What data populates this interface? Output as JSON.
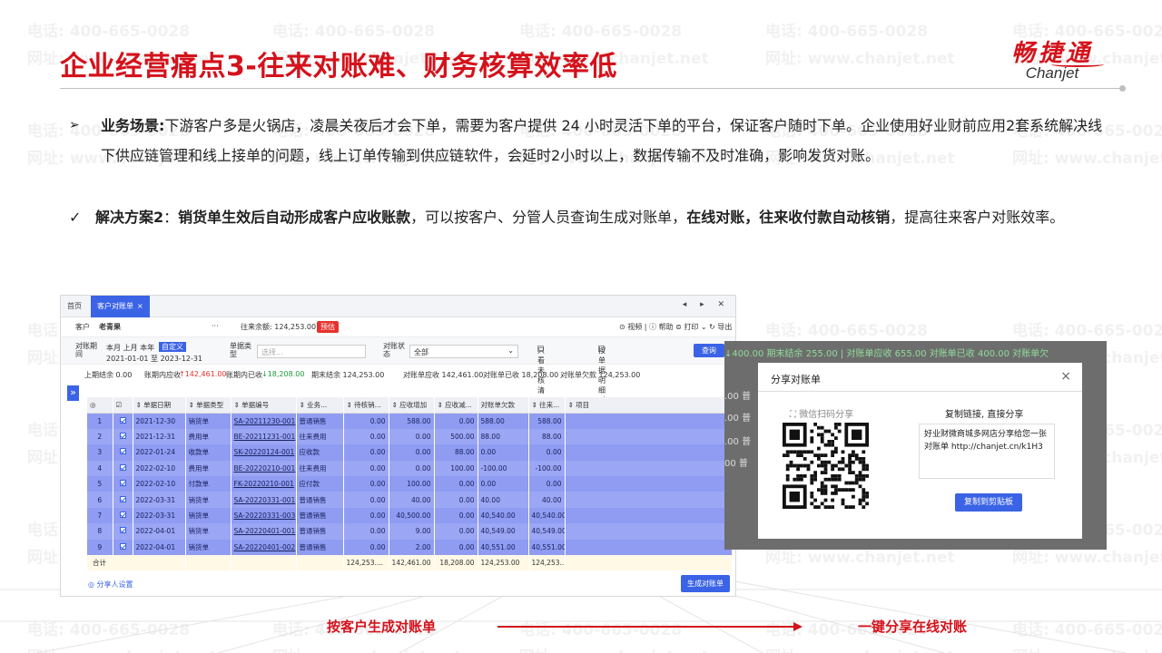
{
  "watermark": {
    "phone": "电话: 400-665-0028",
    "site": "网址: www.chanjet.net"
  },
  "header": {
    "title": "企业经营痛点3-往来对账难、财务核算效率低"
  },
  "logo": {
    "cn": "畅捷通",
    "en": "Chanjet"
  },
  "bullets": {
    "scene_mark": "➢",
    "scene_label": "业务场景:",
    "scene_text": "下游客户多是火锅店，凌晨关夜后才会下单，需要为客户提供 24 小时灵活下单的平台，保证客户随时下单。企业使用好业财前应用2套系统解决线下供应链管理和线上接单的问题，线上订单传输到供应链软件，会延时2小时以上，数据传输不及时准确，影响发货对账。",
    "solution_mark": "✓",
    "solution_label": "解决方案2",
    "solution_colon": "：",
    "solution_bold1": "销货单生效后自动形成客户应收账款",
    "solution_text1": "，可以按客户、分管人员查询生成对账单，",
    "solution_bold2": "在线对账，往来收付款自动核销",
    "solution_text2": "，提高往来客户对账效率。"
  },
  "app": {
    "tab_home": "首页",
    "tab_active": "客户对账单",
    "tab_close": "×",
    "nav_arrows": "◂ ▸ ✕",
    "customer_label": "客户",
    "customer_value": "老青果",
    "customer_more": "···",
    "balance_label": "往来余额: 124,253.00",
    "balance_badge": "预估",
    "toolbar_right": "⊙ 视频 | ⓘ 帮助 ⊜ 打印 ⌄ ↻ 导出",
    "filter": {
      "period_label": "对账期间",
      "period_options": "本月  上月  本年",
      "period_active": "自定义",
      "period_range": "2021-01-01 至 2023-12-31",
      "doc_type_label": "单据类型",
      "doc_type_placeholder": "选择...",
      "status_label": "对账状态",
      "status_value": "全部",
      "only_unsettled": "只看未核清",
      "by_doc_detail": "按单据明细对账",
      "query_btn": "查询"
    },
    "summary": {
      "opening": "上期结余  0.00",
      "receivable_label": "账期内应收",
      "receivable_value": "↑142,461.00",
      "received_label": "账期内已收",
      "received_value": "↓18,208.00",
      "closing": "期末结余  124,253.00",
      "stmt_receivable": "对账单应收  142,461.00",
      "stmt_received": "对账单已收  18,208.00",
      "stmt_owed": "对账单欠款  124,253.00"
    },
    "columns": [
      "◎",
      "☑",
      "⇕ 单据日期",
      "⇕ 单据类型",
      "⇕ 单据编号",
      "⇕ 业务...",
      "⇕ 待核销...",
      "⇕ 应收增加",
      "⇕ 应收减...",
      "对账单欠款",
      "⇕ 往来...",
      "⇕ 项目"
    ],
    "rows": [
      {
        "n": "1",
        "date": "2021-12-30",
        "type": "销货单",
        "code": "SA-20211230-001",
        "biz": "普通销售",
        "pending": "0.00",
        "inc": "588.00",
        "dec": "0.00",
        "owed": "588.00",
        "bal": "588.00"
      },
      {
        "n": "2",
        "date": "2021-12-31",
        "type": "费用单",
        "code": "BE-20211231-001",
        "biz": "往来费用",
        "pending": "0.00",
        "inc": "0.00",
        "dec": "500.00",
        "owed": "88.00",
        "bal": "88.00"
      },
      {
        "n": "3",
        "date": "2022-01-24",
        "type": "收款单",
        "code": "SK-20220124-001",
        "biz": "应收款",
        "pending": "0.00",
        "inc": "0.00",
        "dec": "88.00",
        "owed": "0.00",
        "bal": "0.00"
      },
      {
        "n": "4",
        "date": "2022-02-10",
        "type": "费用单",
        "code": "BE-20220210-001",
        "biz": "往来费用",
        "pending": "0.00",
        "inc": "0.00",
        "dec": "100.00",
        "owed": "-100.00",
        "bal": "-100.00"
      },
      {
        "n": "5",
        "date": "2022-02-10",
        "type": "付款单",
        "code": "FK-20220210-001",
        "biz": "应付款",
        "pending": "0.00",
        "inc": "100.00",
        "dec": "0.00",
        "owed": "0.00",
        "bal": "0.00"
      },
      {
        "n": "6",
        "date": "2022-03-31",
        "type": "销货单",
        "code": "SA-20220331-001",
        "biz": "普通销售",
        "pending": "0.00",
        "inc": "40.00",
        "dec": "0.00",
        "owed": "40.00",
        "bal": "40.00"
      },
      {
        "n": "7",
        "date": "2022-03-31",
        "type": "销货单",
        "code": "SA-20220331-003",
        "biz": "普通销售",
        "pending": "0.00",
        "inc": "40,500.00",
        "dec": "0.00",
        "owed": "40,540.00",
        "bal": "40,540.00"
      },
      {
        "n": "8",
        "date": "2022-04-01",
        "type": "销货单",
        "code": "SA-20220401-001",
        "biz": "普通销售",
        "pending": "0.00",
        "inc": "9.00",
        "dec": "0.00",
        "owed": "40,549.00",
        "bal": "40,549.00"
      },
      {
        "n": "9",
        "date": "2022-04-01",
        "type": "销货单",
        "code": "SA-20220401-002",
        "biz": "普通销售",
        "pending": "0.00",
        "inc": "2.00",
        "dec": "0.00",
        "owed": "40,551.00",
        "bal": "40,551.00"
      }
    ],
    "total": {
      "label": "合计",
      "pending": "124,253....",
      "inc": "142,461.00",
      "dec": "18,208.00",
      "owed": "124,253.00",
      "bal": "124,253...."
    },
    "share_settings": "◎ 分享人设置",
    "generate_btn": "生成对账单"
  },
  "share": {
    "bg_head": "↓400.00    期末结余  255.00    |    对账单应收  655.00    对账单已收  400.00    对账单欠",
    "bg_rows": [
      ".00  普",
      ".00  普",
      ".00  普",
      "00  普"
    ],
    "title": "分享对账单",
    "close": "×",
    "qr_label": "微信扫码分享",
    "link_label": "复制链接, 直接分享",
    "link_text": "好业财微商城多网店分享给您一张对账单 http://chanjet.cn/k1H3",
    "copy_btn": "复制到剪贴板"
  },
  "captions": {
    "left": "按客户生成对账单",
    "right": "一键分享在线对账"
  },
  "colors": {
    "brand_red": "#d4121b",
    "primary_blue": "#3b63e6",
    "row_highlight": "#8f9cf2"
  }
}
